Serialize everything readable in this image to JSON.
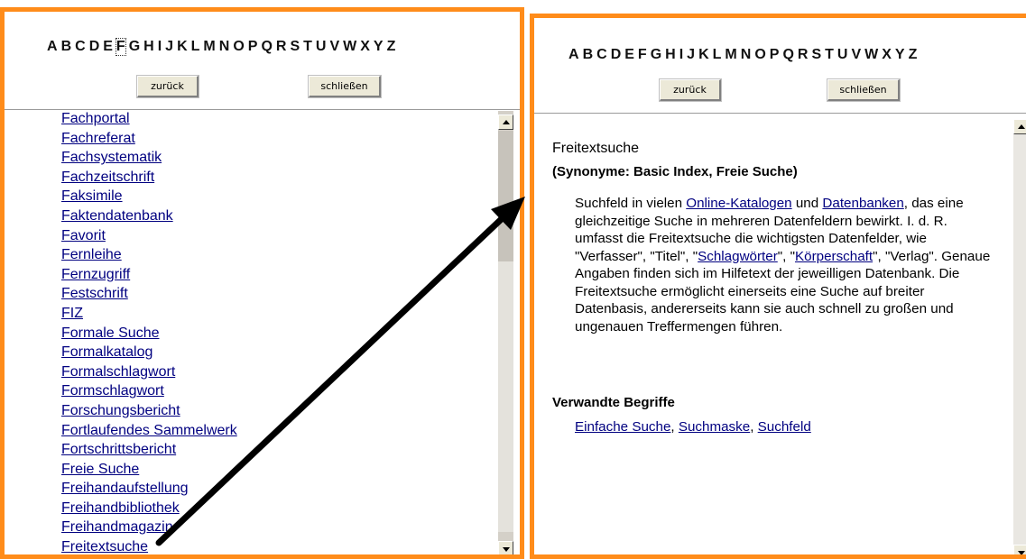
{
  "alphabet": [
    "A",
    "B",
    "C",
    "D",
    "E",
    "F",
    "G",
    "H",
    "I",
    "J",
    "K",
    "L",
    "M",
    "N",
    "O",
    "P",
    "Q",
    "R",
    "S",
    "T",
    "U",
    "V",
    "W",
    "X",
    "Y",
    "Z"
  ],
  "left_panel": {
    "active_letter": "F",
    "back_label": "zurück",
    "close_label": "schließen",
    "terms": [
      "Fachportal",
      "Fachreferat",
      "Fachsystematik",
      "Fachzeitschrift",
      "Faksimile",
      "Faktendatenbank",
      "Favorit",
      "Fernleihe",
      "Fernzugriff",
      "Festschrift",
      "FIZ",
      "Formale Suche",
      "Formalkatalog",
      "Formalschlagwort",
      "Formschlagwort",
      "Forschungsbericht",
      "Fortlaufendes Sammelwerk",
      "Fortschrittsbericht",
      "Freie Suche",
      "Freihandaufstellung",
      "Freihandbibliothek",
      "Freihandmagazin",
      "Freitextsuche"
    ]
  },
  "right_panel": {
    "back_label": "zurück",
    "close_label": "schließen",
    "title": "Freitextsuche",
    "synonyms": "(Synonyme: Basic Index, Freie Suche)",
    "body": {
      "t1": "Suchfeld in vielen ",
      "l1": "Online-Katalogen",
      "t2": " und ",
      "l2": "Datenbanken",
      "t3": ", das eine gleichzeitige Suche in mehreren Datenfeldern bewirkt. I. d. R. umfasst die Freitextsuche die wichtigsten Datenfelder, wie \"Verfasser\", \"Titel\", \"",
      "l3": "Schlagwörter",
      "t4": "\", \"",
      "l4": "Körperschaft",
      "t5": "\", \"Verlag\". Genaue Angaben finden sich im Hilfetext der jeweilligen Datenbank. Die Freitextsuche ermöglicht einerseits eine Suche auf breiter Datenbasis, andererseits kann sie auch schnell zu großen und ungenauen Treffermengen führen."
    },
    "related_heading": "Verwandte Begriffe",
    "related": [
      "Einfache Suche",
      "Suchmaske",
      "Suchfeld"
    ],
    "related_separator": ", "
  },
  "colors": {
    "border": "#ff8c1a",
    "link": "#000080",
    "arrow": "#000000"
  }
}
